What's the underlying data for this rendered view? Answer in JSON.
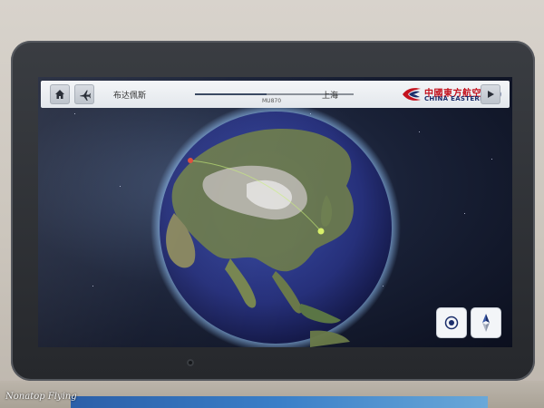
{
  "header": {
    "origin": "布达佩斯",
    "destination": "上海",
    "flight_number": "MU870"
  },
  "airline": {
    "name_cn": "中國東方航空",
    "name_en": "CHINA EASTERN"
  },
  "icons": {
    "home": "home-icon",
    "plane": "plane-icon",
    "play": "play-icon",
    "target": "target-icon",
    "compass": "compass-icon"
  },
  "map": {
    "flight_progress": 0.45
  },
  "watermark": "Nonatop Flying",
  "colors": {
    "airline_red": "#c3121e",
    "airline_blue": "#1b2e6b",
    "route_marker": "#d8f06a"
  }
}
